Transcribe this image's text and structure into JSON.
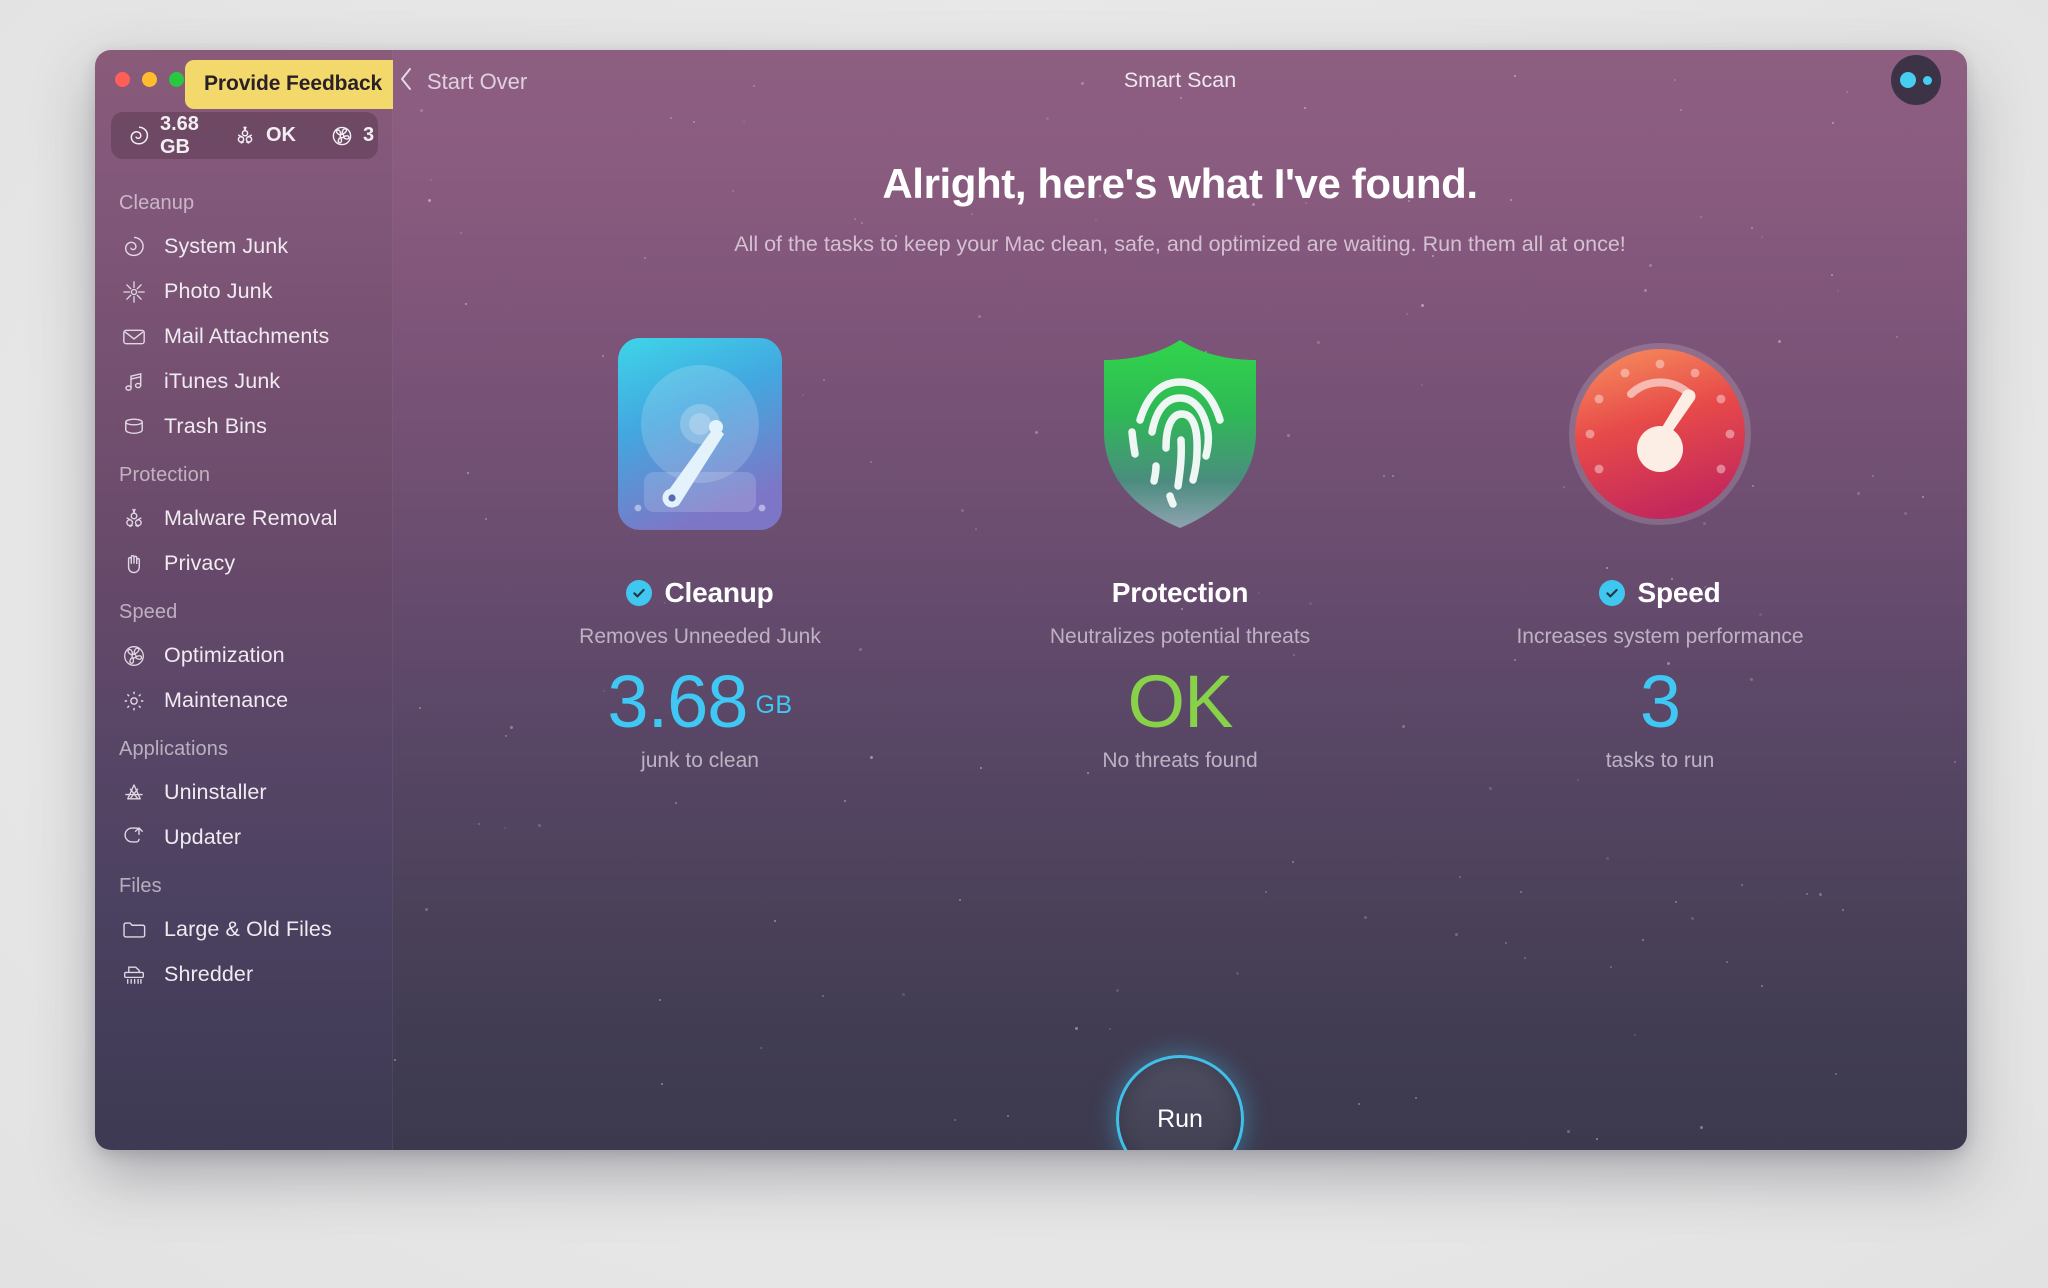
{
  "window": {
    "title": "Smart Scan",
    "feedback_label": "Provide Feedback",
    "back_label": "Start Over",
    "back_icon": "chevron-left-icon",
    "assistant_icon": "assistant-dots-icon",
    "traffic_lights": [
      "close",
      "minimize",
      "zoom"
    ]
  },
  "status_pill": [
    {
      "icon": "system-junk-icon",
      "value": "3.68 GB"
    },
    {
      "icon": "biohazard-icon",
      "value": "OK"
    },
    {
      "icon": "fan-icon",
      "value": "3"
    }
  ],
  "sidebar": {
    "sections": [
      {
        "title": "Cleanup",
        "items": [
          {
            "label": "System Junk",
            "icon": "system-junk-icon"
          },
          {
            "label": "Photo Junk",
            "icon": "photo-junk-icon"
          },
          {
            "label": "Mail Attachments",
            "icon": "mail-icon"
          },
          {
            "label": "iTunes Junk",
            "icon": "music-note-icon"
          },
          {
            "label": "Trash Bins",
            "icon": "trash-bin-icon"
          }
        ]
      },
      {
        "title": "Protection",
        "items": [
          {
            "label": "Malware Removal",
            "icon": "biohazard-icon"
          },
          {
            "label": "Privacy",
            "icon": "hand-icon"
          }
        ]
      },
      {
        "title": "Speed",
        "items": [
          {
            "label": "Optimization",
            "icon": "fan-icon"
          },
          {
            "label": "Maintenance",
            "icon": "gear-icon"
          }
        ]
      },
      {
        "title": "Applications",
        "items": [
          {
            "label": "Uninstaller",
            "icon": "uninstaller-icon"
          },
          {
            "label": "Updater",
            "icon": "updater-icon"
          }
        ]
      },
      {
        "title": "Files",
        "items": [
          {
            "label": "Large & Old Files",
            "icon": "folder-icon"
          },
          {
            "label": "Shredder",
            "icon": "shredder-icon"
          }
        ]
      }
    ]
  },
  "main": {
    "headline": "Alright, here's what I've found.",
    "subhead": "All of the tasks to keep your Mac clean, safe, and optimized are waiting. Run them all at once!",
    "cards": [
      {
        "id": "cleanup",
        "art_icon": "hard-drive-icon",
        "title": "Cleanup",
        "checked": true,
        "subtitle": "Removes Unneeded Junk",
        "value": "3.68",
        "unit": "GB",
        "value_color": "#40c8f4",
        "caption": "junk to clean"
      },
      {
        "id": "protection",
        "art_icon": "shield-fingerprint-icon",
        "title": "Protection",
        "checked": false,
        "subtitle": "Neutralizes potential threats",
        "value": "OK",
        "unit": "",
        "value_color": "#88d24a",
        "caption": "No threats found"
      },
      {
        "id": "speed",
        "art_icon": "speedometer-icon",
        "title": "Speed",
        "checked": true,
        "subtitle": "Increases system performance",
        "value": "3",
        "unit": "",
        "value_color": "#40c8f4",
        "caption": "tasks to run"
      }
    ],
    "run_label": "Run"
  },
  "colors": {
    "accent_cyan": "#40c8f4",
    "accent_green": "#88d24a",
    "feedback_yellow": "#f3d96b",
    "bg_top": "#8d5e80",
    "bg_bottom": "#3c394e"
  }
}
